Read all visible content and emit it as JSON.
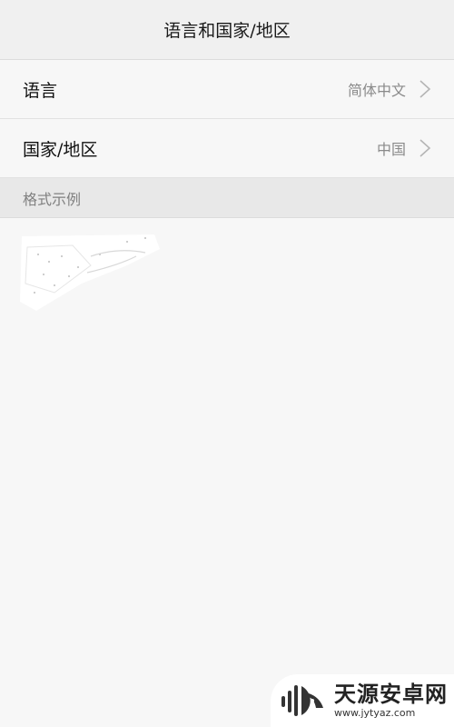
{
  "header": {
    "title": "语言和国家/地区"
  },
  "settings": [
    {
      "label": "语言",
      "value": "简体中文"
    },
    {
      "label": "国家/地区",
      "value": "中国"
    }
  ],
  "format_section": {
    "title": "格式示例"
  },
  "watermark": {
    "name": "天源安卓网",
    "url": "www.jytyaz.com"
  },
  "colors": {
    "background": "#f7f7f7",
    "header_bg": "#f0f0f0",
    "section_bg": "#e8e8e8",
    "value_text": "#8a8a8a"
  }
}
